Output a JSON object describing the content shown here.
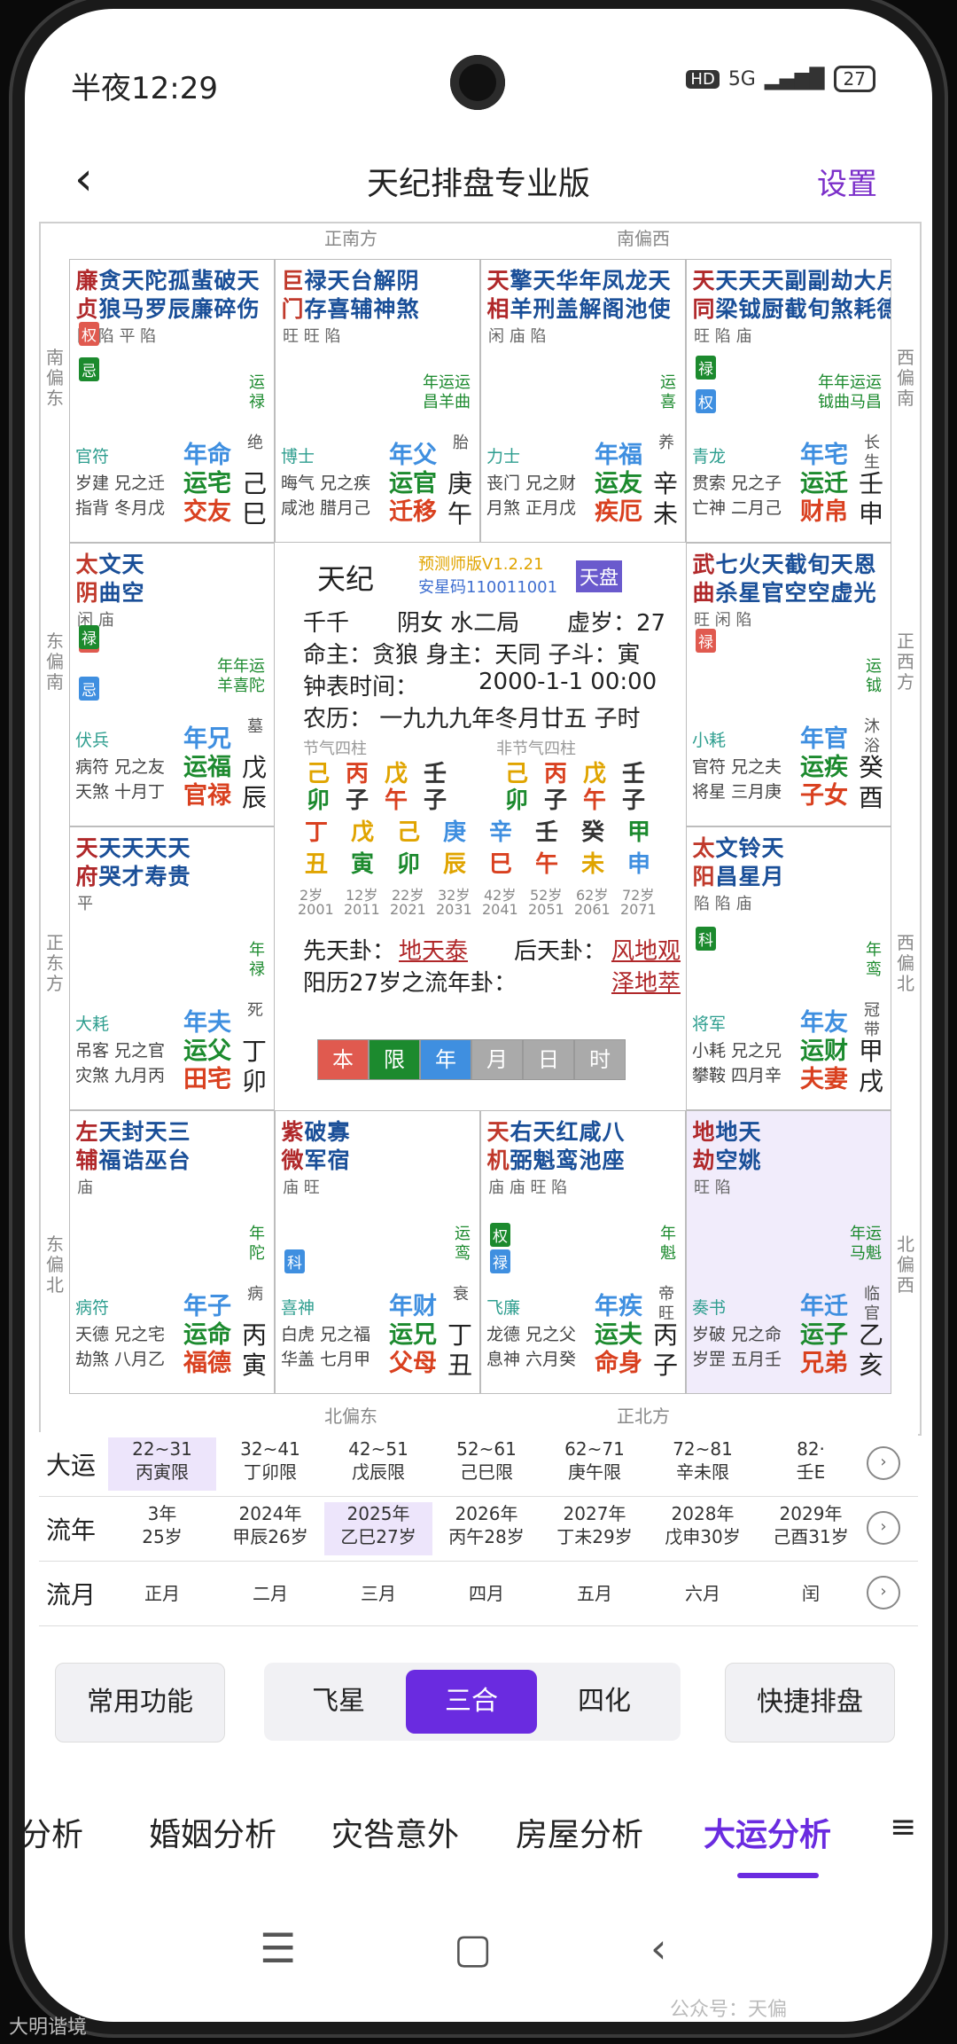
{
  "status": {
    "time": "半夜12:29",
    "hd": "HD",
    "net": "5G",
    "battery": "27"
  },
  "header": {
    "back": "‹",
    "title": "天纪排盘专业版",
    "settings": "设置"
  },
  "directions": {
    "top1": "正南方",
    "top2": "南偏西",
    "bottom1": "北偏东",
    "bottom2": "正北方",
    "left1": "南\n偏\n东",
    "left2": "东\n偏\n南",
    "left3": "正\n东\n方",
    "left4": "东\n偏\n北",
    "right1": "西\n偏\n南",
    "right2": "正\n西\n方",
    "right3": "西\n偏\n北",
    "right4": "北\n偏\n西"
  },
  "cells": [
    {
      "stars": [
        [
          "廉",
          "贞"
        ],
        [
          "贪",
          "狼"
        ],
        [
          "天",
          "马"
        ],
        [
          "陀",
          "罗"
        ],
        [
          "孤",
          "辰"
        ],
        [
          "蜚",
          "廉"
        ],
        [
          "破",
          "碎"
        ],
        [
          "天",
          "伤"
        ]
      ],
      "bright": "陷 陷 平 陷",
      "tr": "运\n禄",
      "god": "官符",
      "sub": "岁建 兄之迁\n指背 冬月戊",
      "p1": "年命",
      "p2": "运宅",
      "p3": "交友",
      "gz": "己\n巳",
      "life": "绝"
    },
    {
      "stars": [
        [
          "巨",
          "门"
        ],
        [
          "禄",
          "存"
        ],
        [
          "天",
          "喜"
        ],
        [
          "台",
          "辅"
        ],
        [
          "解",
          "神"
        ],
        [
          "阴",
          "煞"
        ]
      ],
      "bright": "旺 旺 陷",
      "tr": "年运运\n昌羊曲",
      "god": "博士",
      "sub": "晦气 兄之疾\n咸池 腊月己",
      "p1": "年父",
      "p2": "运官",
      "p3": "迁移",
      "gz": "庚\n午",
      "life": "胎"
    },
    {
      "stars": [
        [
          "天",
          "相"
        ],
        [
          "擎",
          "羊"
        ],
        [
          "天",
          "刑"
        ],
        [
          "华",
          "盖"
        ],
        [
          "年",
          "解"
        ],
        [
          "凤",
          "阁"
        ],
        [
          "龙",
          "池"
        ],
        [
          "天",
          "使"
        ]
      ],
      "bright": "闲 庙 陷",
      "tr": "运\n喜",
      "god": "力士",
      "sub": "丧门 兄之财\n月煞 正月戊",
      "p1": "年福",
      "p2": "运友",
      "p3": "疾厄",
      "gz": "辛\n未",
      "life": "养"
    },
    {
      "stars": [
        [
          "天",
          "同"
        ],
        [
          "天",
          "梁"
        ],
        [
          "天",
          "钺"
        ],
        [
          "天",
          "厨"
        ],
        [
          "副",
          "截"
        ],
        [
          "副",
          "旬"
        ],
        [
          "劫",
          "煞"
        ],
        [
          "大",
          "耗"
        ],
        [
          "月",
          "德"
        ]
      ],
      "bright": "旺 陷 庙",
      "tr": "年年运运\n钺曲马昌",
      "god": "青龙",
      "sub": "贯索 兄之子\n亡神 二月己",
      "p1": "年宅",
      "p2": "运迁",
      "p3": "财帛",
      "gz": "壬\n申",
      "life": "长\n生"
    },
    {
      "stars": [
        [
          "太",
          "阴"
        ],
        [
          "文",
          "曲"
        ],
        [
          "天",
          "空"
        ]
      ],
      "bright": "闲 庙",
      "tr": "年年运\n羊喜陀",
      "god": "伏兵",
      "sub": "病符 兄之友\n天煞 十月丁",
      "p1": "年兄",
      "p2": "运福",
      "p3": "官禄",
      "gz": "戊\n辰",
      "life": "墓"
    },
    {
      "stars": [
        [
          "武",
          "曲"
        ],
        [
          "七",
          "杀"
        ],
        [
          "火",
          "星"
        ],
        [
          "天",
          "官"
        ],
        [
          "截",
          "空"
        ],
        [
          "旬",
          "空"
        ],
        [
          "天",
          "虚"
        ],
        [
          "恩",
          "光"
        ]
      ],
      "bright": "旺 闲 陷",
      "tr": "运\n钺",
      "god": "小耗",
      "sub": "官符 兄之夫\n将星 三月庚",
      "p1": "年官",
      "p2": "运疾",
      "p3": "子女",
      "gz": "癸\n酉",
      "life": "沐\n浴"
    },
    {
      "stars": [
        [
          "天",
          "府"
        ],
        [
          "天",
          "哭"
        ],
        [
          "天",
          "才"
        ],
        [
          "天",
          "寿"
        ],
        [
          "天",
          "贵"
        ]
      ],
      "bright": "平",
      "tr": "年\n禄",
      "god": "大耗",
      "sub": "吊客 兄之官\n灾煞 九月丙",
      "p1": "年夫",
      "p2": "运父",
      "p3": "田宅",
      "gz": "丁\n卯",
      "life": "死"
    },
    {
      "stars": [
        [
          "太",
          "阳"
        ],
        [
          "文",
          "昌"
        ],
        [
          "铃",
          "星"
        ],
        [
          "天",
          "月"
        ]
      ],
      "bright": "陷 陷 庙",
      "tr": "年\n鸾",
      "god": "将军",
      "sub": "小耗 兄之兄\n攀鞍 四月辛",
      "p1": "年友",
      "p2": "运财",
      "p3": "夫妻",
      "gz": "甲\n戌",
      "life": "冠\n带"
    },
    {
      "stars": [
        [
          "左",
          "辅"
        ],
        [
          "天",
          "福"
        ],
        [
          "封",
          "诰"
        ],
        [
          "天",
          "巫"
        ],
        [
          "三",
          "台"
        ]
      ],
      "bright": "庙",
      "tr": "年\n陀",
      "god": "病符",
      "sub": "天德 兄之宅\n劫煞 八月乙",
      "p1": "年子",
      "p2": "运命",
      "p3": "福德",
      "gz": "丙\n寅",
      "life": "病"
    },
    {
      "stars": [
        [
          "紫",
          "微"
        ],
        [
          "破",
          "军"
        ],
        [
          "寡",
          "宿"
        ]
      ],
      "bright": "庙 旺",
      "tr": "运\n鸾",
      "god": "喜神",
      "sub": "白虎 兄之福\n华盖 七月甲",
      "p1": "年财",
      "p2": "运兄",
      "p3": "父母",
      "gz": "丁\n丑",
      "life": "衰"
    },
    {
      "stars": [
        [
          "天",
          "机"
        ],
        [
          "右",
          "弼"
        ],
        [
          "天",
          "魁"
        ],
        [
          "红",
          "鸾"
        ],
        [
          "咸",
          "池"
        ],
        [
          "八",
          "座"
        ]
      ],
      "bright": "庙 庙 旺 陷",
      "tr": "年\n魁",
      "god": "飞廉",
      "sub": "龙德 兄之父\n息神 六月癸",
      "p1": "年疾",
      "p2": "运夫",
      "p3": "命身",
      "gz": "丙\n子",
      "life": "帝\n旺"
    },
    {
      "stars": [
        [
          "地",
          "劫"
        ],
        [
          "地",
          "空"
        ],
        [
          "天",
          "姚"
        ]
      ],
      "bright": "旺 陷",
      "tr": "年运\n马魁",
      "god": "奏书",
      "sub": "岁破 兄之命\n岁罡 五月壬",
      "p1": "年迁",
      "p2": "运子",
      "p3": "兄弟",
      "gz": "乙\n亥",
      "life": "临\n官"
    }
  ],
  "center": {
    "name": "天纪",
    "version": "预测师版V1.2.21",
    "code": "安星码110011001",
    "pan": "天盘",
    "l1a": "千千",
    "l1b": "阴女 水二局",
    "l1c": "虚岁：27",
    "l2": "命主：贪狼  身主：天同  子斗：寅",
    "l3a": "钟表时间：",
    "l3b": "2000-1-1 00:00",
    "l4": "农历：  一九九九年冬月廿五 子时",
    "jq": "节气四柱",
    "fjq": "非节气四柱",
    "p_top": [
      "己",
      "丙",
      "戊",
      "壬",
      "己",
      "丙",
      "戊",
      "壬"
    ],
    "p_bot": [
      "卯",
      "子",
      "午",
      "子",
      "卯",
      "子",
      "午",
      "子"
    ],
    "stems": [
      "丁",
      "戊",
      "己",
      "庚",
      "辛",
      "壬",
      "癸",
      "甲"
    ],
    "branches": [
      "丑",
      "寅",
      "卯",
      "辰",
      "巳",
      "午",
      "未",
      "申"
    ],
    "ages": [
      "2岁",
      "12岁",
      "22岁",
      "32岁",
      "42岁",
      "52岁",
      "62岁",
      "72岁"
    ],
    "years": [
      "2001",
      "2011",
      "2021",
      "2031",
      "2041",
      "2051",
      "2061",
      "2071"
    ],
    "xt": "先天卦：",
    "xtv": "地天泰",
    "ht": "后天卦：",
    "htv": "风地观",
    "ln": "阳历27岁之流年卦：",
    "lnv": "泽地萃",
    "tabs": [
      "本",
      "限",
      "年",
      "月",
      "日",
      "时"
    ]
  },
  "dayun": {
    "label": "大运",
    "items": [
      [
        "22~31",
        "丙寅限"
      ],
      [
        "32~41",
        "丁卯限"
      ],
      [
        "42~51",
        "戊辰限"
      ],
      [
        "52~61",
        "己巳限"
      ],
      [
        "62~71",
        "庚午限"
      ],
      [
        "72~81",
        "辛未限"
      ],
      [
        "82·",
        "壬E"
      ]
    ]
  },
  "liunian": {
    "label": "流年",
    "items": [
      [
        "3年",
        "25岁"
      ],
      [
        "2024年",
        "甲辰26岁"
      ],
      [
        "2025年",
        "乙巳27岁"
      ],
      [
        "2026年",
        "丙午28岁"
      ],
      [
        "2027年",
        "丁未29岁"
      ],
      [
        "2028年",
        "戊申30岁"
      ],
      [
        "2029年",
        "己酉31岁"
      ]
    ]
  },
  "liuyue": {
    "label": "流月",
    "items": [
      "正月",
      "二月",
      "三月",
      "四月",
      "五月",
      "六月",
      "闰"
    ]
  },
  "buttons": {
    "common": "常用功能",
    "fly": "飞星",
    "sanhe": "三合",
    "sihua": "四化",
    "quick": "快捷排盘"
  },
  "tabs": [
    "分析",
    "婚姻分析",
    "灾咎意外",
    "房屋分析",
    "大运分析",
    "≡"
  ],
  "watermark": {
    "a": "公众号：天偏",
    "b": "大明谐境"
  }
}
